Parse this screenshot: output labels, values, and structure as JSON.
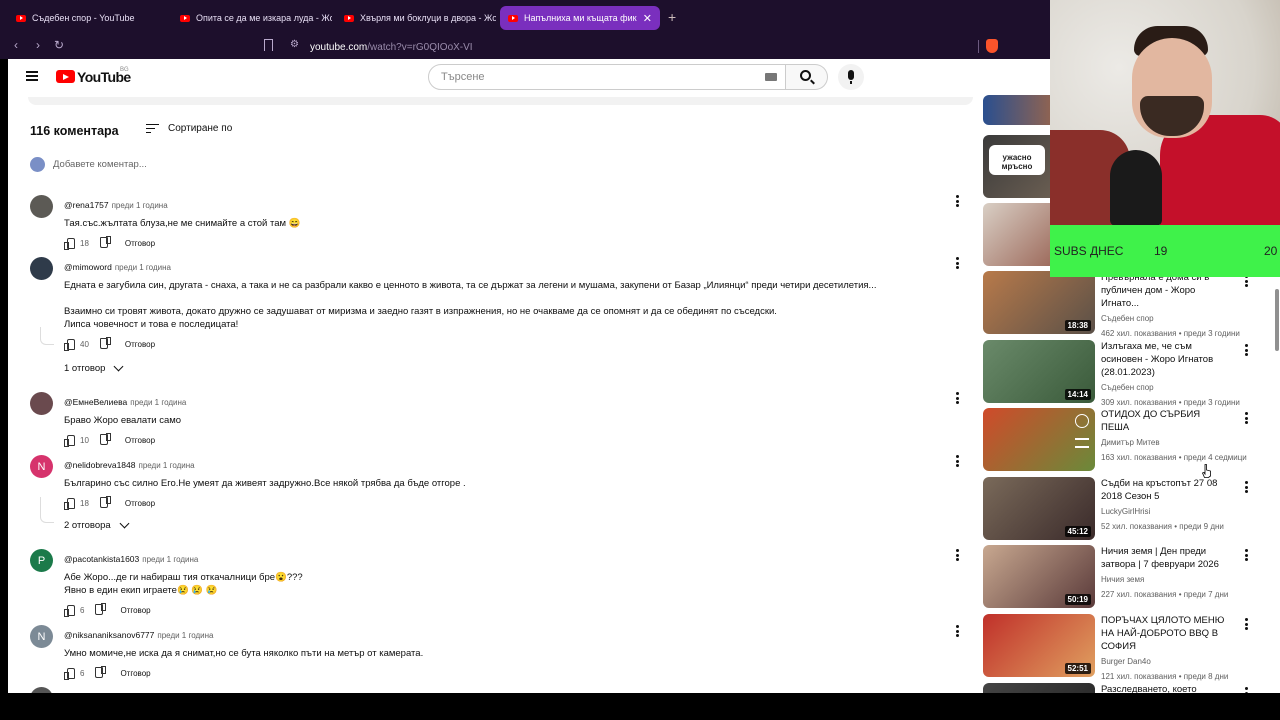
{
  "browser": {
    "tabs": [
      {
        "label": "Съдебен спор - YouTube",
        "active": false
      },
      {
        "label": "Опита се да ме изкара луда - Жор",
        "active": false
      },
      {
        "label": "Хвърля ми боклуци в двора - Жор",
        "active": false
      },
      {
        "label": "Напълниха ми къщата фикаели",
        "active": true
      }
    ],
    "url_host": "youtube.com",
    "url_path": "/watch?v=rG0QIOoX-VI"
  },
  "youtube": {
    "logo": "YouTube",
    "country": "BG",
    "search_placeholder": "Търсене"
  },
  "comments_section": {
    "count_label": "116 коментара",
    "sort_label": "Сортиране по",
    "add_placeholder": "Добавете коментар...",
    "reply_label": "Отговор",
    "comments": [
      {
        "handle": "@rena1757",
        "time": "преди 1 година",
        "text": "Тая.със.жълтата блуза,не ме снимайте а стой там 😄",
        "likes": "18"
      },
      {
        "handle": "@mimoword",
        "time": "преди 1 година",
        "text": "Едната е загубила син, другата - снаха, а така и не са разбрали какво е ценното в живота, та се държат за легени и мушама, закупени от Базар „Илиянци“ преди четири десетилетия...\n\nВзаимно си тровят живота, докато дружно се задушават от миризма и заедно газят в изпражнения, но не очакваме да се опомнят и да се обединят по съседски.\nЛипса човечност и това е последицата!",
        "likes": "40",
        "replies_label": "1 отговор"
      },
      {
        "handle": "@ЕмнеВелиева",
        "time": "преди 1 година",
        "text": "Браво Жоро евалати само",
        "likes": "10"
      },
      {
        "handle": "@nelidobreva1848",
        "time": "преди 1 година",
        "text": "Българино със силно Его.Не умеят да живеят задружно.Все някой трябва да бъде отгоре .",
        "likes": "18",
        "replies_label": "2 отговора",
        "avatar_letter": "N"
      },
      {
        "handle": "@pacotankista1603",
        "time": "преди 1 година",
        "text": "Абе Жоро...де ги набираш тия откачалници бре😮???\nЯвно в един екип играете😢 😢 😢",
        "likes": "6",
        "avatar_letter": "P"
      },
      {
        "handle": "@niksananiksanov6777",
        "time": "преди 1 година",
        "text": "Умно момиче,не иска да я снимат,но се бута няколко пъти на метър от камерата.",
        "likes": "6",
        "avatar_letter": "N"
      }
    ]
  },
  "sidebar_videos": [
    {
      "title": "Превърнала е дома си в публичен дом - Жоро Игнато...",
      "channel": "Съдебен спор",
      "meta": "462 хил. показвания • преди 3 години",
      "duration": "18:38"
    },
    {
      "title": "Излъгаха ме, че съм осиновен - Жоро Игнатов (28.01.2023)",
      "channel": "Съдебен спор",
      "meta": "309 хил. показвания • преди 3 години",
      "duration": "14:14"
    },
    {
      "title": "ОТИДОХ ДО СЪРБИЯ ПЕША",
      "channel": "Димитър Митев",
      "meta": "163 хил. показвания • преди 4 седмици",
      "duration": ""
    },
    {
      "title": "Съдби на кръстопът 27 08 2018   Сезон 5",
      "channel": "LuckyGirlHrisi",
      "meta": "52 хил. показвания • преди 9 дни",
      "duration": "45:12"
    },
    {
      "title": "Ничия земя | Ден преди затвора | 7 февруари 2026",
      "channel": "Ничия земя",
      "meta": "227 хил. показвания • преди 7 дни",
      "duration": "50:19"
    },
    {
      "title": "ПОРЪЧАХ ЦЯЛОТО МЕНЮ НА НАЙ-ДОБРОТО BBQ В СОФИЯ",
      "channel": "Burger Dan4o",
      "meta": "121 хил. показвания • преди 8 дни",
      "duration": "52:51"
    },
    {
      "title": "Разследването, което",
      "channel": "",
      "meta": "",
      "duration": ""
    }
  ],
  "top_thumbs": [
    {
      "text": "ужасно мръсно"
    }
  ],
  "stream_overlay": {
    "label": "SUBS ДНЕС",
    "value": "19",
    "goal": "20"
  },
  "colors": {
    "youtube_red": "#ff0000",
    "active_tab": "#7a2fbe",
    "subs_bar": "#3ff24a"
  }
}
